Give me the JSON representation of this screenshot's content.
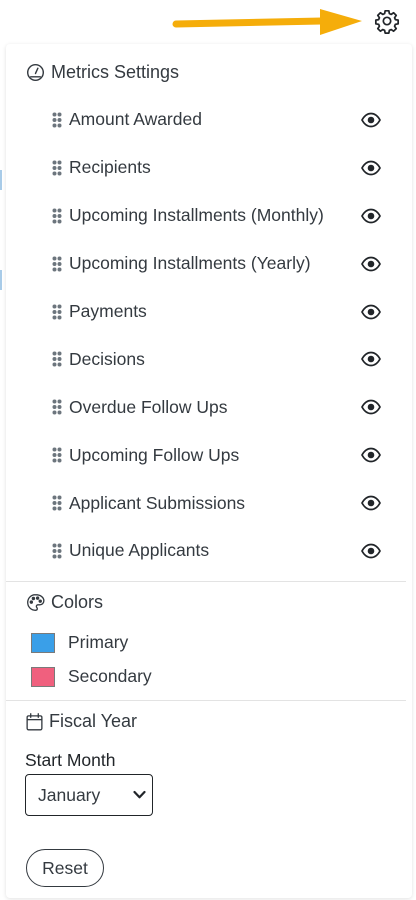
{
  "toolbar": {
    "settings_icon": "gear-icon",
    "pointer": "arrow-right-icon",
    "accent_color": "#f5ad0a"
  },
  "metrics": {
    "title": "Metrics Settings",
    "icon": "gauge-icon",
    "items": [
      {
        "label": "Amount Awarded",
        "visible_icon": "eye-icon"
      },
      {
        "label": "Recipients",
        "visible_icon": "eye-icon"
      },
      {
        "label": "Upcoming Installments (Monthly)",
        "visible_icon": "eye-icon"
      },
      {
        "label": "Upcoming Installments (Yearly)",
        "visible_icon": "eye-icon"
      },
      {
        "label": "Payments",
        "visible_icon": "eye-icon"
      },
      {
        "label": "Decisions",
        "visible_icon": "eye-icon"
      },
      {
        "label": "Overdue Follow Ups",
        "visible_icon": "eye-icon"
      },
      {
        "label": "Upcoming Follow Ups",
        "visible_icon": "eye-icon"
      },
      {
        "label": "Applicant Submissions",
        "visible_icon": "eye-icon"
      },
      {
        "label": "Unique Applicants",
        "visible_icon": "eye-icon"
      }
    ]
  },
  "colors": {
    "title": "Colors",
    "icon": "palette-icon",
    "primary": {
      "label": "Primary",
      "value": "#3a9fe8"
    },
    "secondary": {
      "label": "Secondary",
      "value": "#f0607e"
    }
  },
  "fiscal_year": {
    "title": "Fiscal Year",
    "icon": "calendar-icon",
    "start_month_label": "Start Month",
    "start_month_value": "January"
  },
  "actions": {
    "reset_label": "Reset"
  }
}
